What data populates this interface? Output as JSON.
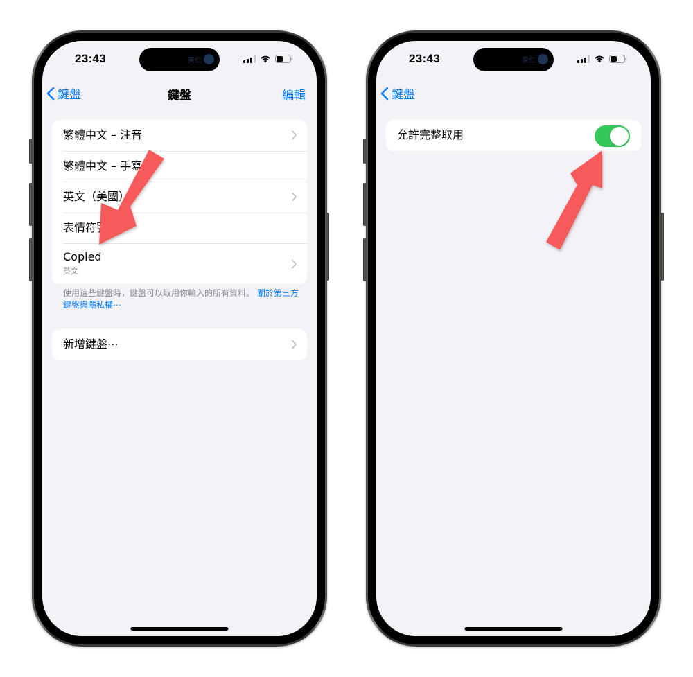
{
  "phones": [
    {
      "status_bar": {
        "time": "23:43",
        "island_label": "果仁",
        "signal_bars_on": 3,
        "signal_bars_total": 4,
        "battery_level_pct": 40,
        "icons": [
          "cellular-signal-icon",
          "wifi-icon",
          "battery-icon"
        ]
      },
      "nav": {
        "back_label": "鍵盤",
        "title": "鍵盤",
        "edit_label": "編輯"
      },
      "keyboards": [
        {
          "title": "繁體中文 – 注音",
          "chevron": true
        },
        {
          "title": "繁體中文 – 手寫",
          "chevron": false
        },
        {
          "title": "英文（美國）",
          "chevron": true
        },
        {
          "title": "表情符號",
          "chevron": false
        },
        {
          "title": "Copied",
          "subtitle": "英文",
          "chevron": true
        }
      ],
      "footer": {
        "text": "使用這些鍵盤時，鍵盤可以取用你輸入的所有資料。 ",
        "link": "關於第三方鍵盤與隱私權⋯"
      },
      "add_keyboard_label": "新增鍵盤⋯"
    },
    {
      "status_bar": {
        "time": "23:43",
        "island_label": "果仁",
        "signal_bars_on": 3,
        "signal_bars_total": 4,
        "battery_level_pct": 40
      },
      "nav": {
        "back_label": "鍵盤"
      },
      "settings": [
        {
          "label": "允許完整取用",
          "toggle_on": true
        }
      ]
    }
  ],
  "annotations": {
    "arrow_color": "#f65a5a",
    "arrows": [
      {
        "phone": "left",
        "points_to": "Copied"
      },
      {
        "phone": "right",
        "points_to": "允許完整取用 toggle"
      }
    ]
  },
  "colors": {
    "accent_blue": "#007aff",
    "toggle_green": "#34c759",
    "background": "#f2f2f7"
  }
}
